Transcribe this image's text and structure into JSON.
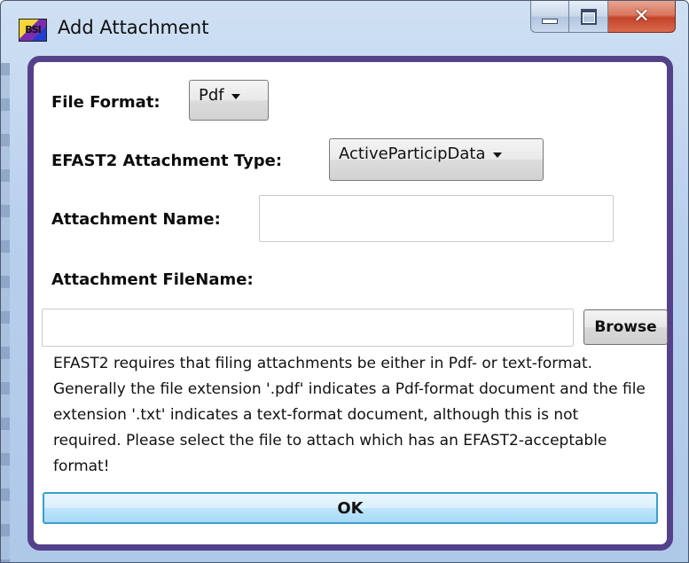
{
  "window": {
    "title": "Add Attachment",
    "app_icon_text": "BSI"
  },
  "form": {
    "file_format_label": "File Format:",
    "file_format_value": "Pdf",
    "attachment_type_label": "EFAST2 Attachment Type:",
    "attachment_type_value": "ActiveParticipData",
    "attachment_name_label": "Attachment Name:",
    "attachment_name_value": "",
    "attachment_filename_label": "Attachment FileName:",
    "attachment_filename_value": "",
    "browse_label": "Browse",
    "description": "EFAST2 requires that filing attachments be either in Pdf- or text-format. Generally the file extension '.pdf' indicates a Pdf-format document and the file extension '.txt' indicates a text-format document, although this is not required. Please select the file to attach which has an EFAST2-acceptable format!",
    "ok_label": "OK"
  },
  "colors": {
    "frame_accent": "#55418a",
    "ok_border": "#3c9ecf",
    "close_button": "#c4432a"
  }
}
